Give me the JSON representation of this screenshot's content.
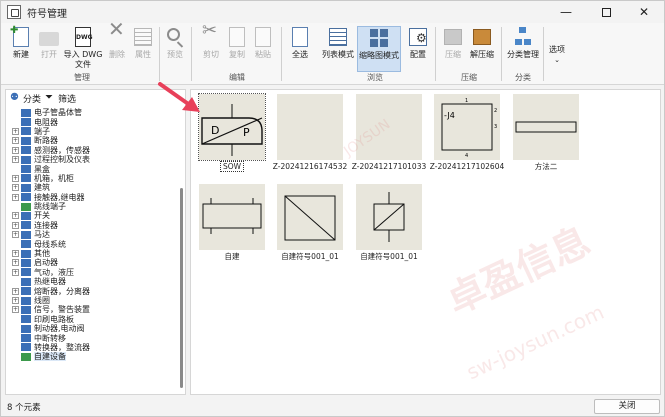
{
  "window": {
    "title": "符号管理"
  },
  "ribbon": {
    "buttons": {
      "new": "新建",
      "open": "打开",
      "import_dwg": "导入 DWG\n文件",
      "delete": "删除",
      "properties": "属性",
      "preview": "预览",
      "cut": "剪切",
      "copy": "复制",
      "paste": "粘贴",
      "select_all": "全选",
      "list_mode": "列表模式",
      "thumbnail_mode": "缩略图模式",
      "config": "配置",
      "compress": "压缩",
      "decompress": "解压缩",
      "category_mgmt": "分类管理",
      "options": "选项"
    },
    "groups": {
      "manage": "管理",
      "edit": "编辑",
      "browse": "浏览",
      "compress": "压缩",
      "category": "分类"
    }
  },
  "left_panel": {
    "tab_category": "分类",
    "tab_filter": "筛选",
    "tree": [
      {
        "label": "电子管晶体管",
        "expandable": false
      },
      {
        "label": "电阻器",
        "expandable": false
      },
      {
        "label": "端子",
        "expandable": true
      },
      {
        "label": "断路器",
        "expandable": true
      },
      {
        "label": "感测器，传感器",
        "expandable": true
      },
      {
        "label": "过程控制及仪表",
        "expandable": true
      },
      {
        "label": "黑盒",
        "expandable": false
      },
      {
        "label": "机箱，机柜",
        "expandable": true
      },
      {
        "label": "建筑",
        "expandable": true
      },
      {
        "label": "接触器,继电器",
        "expandable": true
      },
      {
        "label": "跳线端子",
        "expandable": false,
        "green": true
      },
      {
        "label": "开关",
        "expandable": true
      },
      {
        "label": "连接器",
        "expandable": true
      },
      {
        "label": "马达",
        "expandable": true
      },
      {
        "label": "母线系统",
        "expandable": false
      },
      {
        "label": "其他",
        "expandable": true
      },
      {
        "label": "启动器",
        "expandable": true
      },
      {
        "label": "气动，液压",
        "expandable": true
      },
      {
        "label": "热继电器",
        "expandable": false
      },
      {
        "label": "熔断器，分离器",
        "expandable": true
      },
      {
        "label": "线圈",
        "expandable": true
      },
      {
        "label": "信号，警告装置",
        "expandable": true
      },
      {
        "label": "印刷电路板",
        "expandable": false
      },
      {
        "label": "制动器,电动阀",
        "expandable": false
      },
      {
        "label": "中断转移",
        "expandable": false
      },
      {
        "label": "转换器，整流器",
        "expandable": false
      },
      {
        "label": "自建设备",
        "expandable": false,
        "green": true,
        "selected": true
      }
    ]
  },
  "thumbnails": [
    {
      "caption": "SOW",
      "selected": true,
      "glyph_labels": [
        "D",
        "P"
      ]
    },
    {
      "caption": "Z-20241216174532"
    },
    {
      "caption": "Z-20241217101033"
    },
    {
      "caption": "Z-20241217102604",
      "glyph_labels": [
        "-J4",
        "1",
        "2",
        "3",
        "4"
      ]
    },
    {
      "caption": "方法二"
    },
    {
      "caption": "自建"
    },
    {
      "caption": "自建符号001_01"
    },
    {
      "caption": "自建符号001_01"
    }
  ],
  "watermark": {
    "main": "卓盈信息",
    "sub": "sw-joysun.com",
    "ring": "JOYSUN"
  },
  "status": {
    "count_text": "8 个元素",
    "close_label": "关闭"
  },
  "colors": {
    "accent": "#cfe0f3",
    "thumb_bg": "#e8e6dc",
    "annotation": "#e8405a"
  }
}
